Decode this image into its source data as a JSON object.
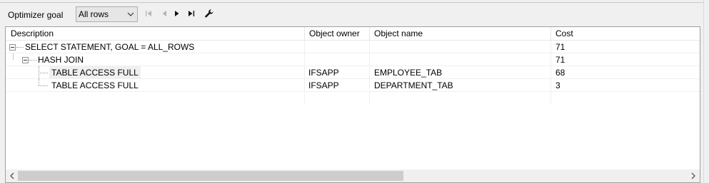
{
  "toolbar": {
    "goal_label": "Optimizer goal",
    "goal_value": "All rows"
  },
  "grid": {
    "columns": [
      "Description",
      "Object owner",
      "Object name",
      "Cost"
    ],
    "rows": [
      {
        "description": "SELECT STATEMENT, GOAL = ALL_ROWS",
        "owner": "",
        "name": "",
        "cost": "71"
      },
      {
        "description": "HASH JOIN",
        "owner": "",
        "name": "",
        "cost": "71"
      },
      {
        "description": "TABLE ACCESS FULL",
        "owner": "IFSAPP",
        "name": "EMPLOYEE_TAB",
        "cost": "68"
      },
      {
        "description": "TABLE ACCESS FULL",
        "owner": "IFSAPP",
        "name": "DEPARTMENT_TAB",
        "cost": "3"
      }
    ]
  }
}
